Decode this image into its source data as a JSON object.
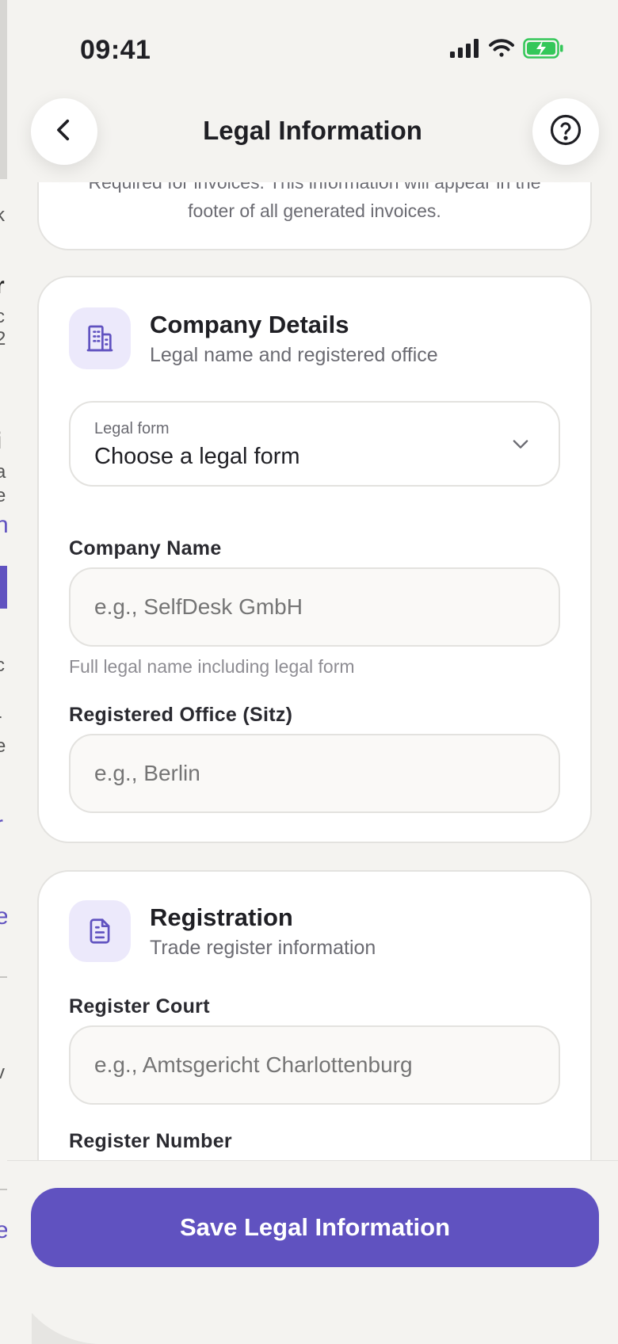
{
  "status_bar": {
    "time": "09:41"
  },
  "header": {
    "title": "Legal Information"
  },
  "info_card": {
    "text": "Required for invoices. This information will appear in the footer of all generated invoices."
  },
  "company_section": {
    "title": "Company Details",
    "subtitle": "Legal name and registered office",
    "legal_form": {
      "label": "Legal form",
      "value": "Choose a legal form"
    },
    "company_name": {
      "label": "Company Name",
      "placeholder": "e.g., SelfDesk GmbH",
      "help": "Full legal name including legal form"
    },
    "registered_office": {
      "label": "Registered Office (Sitz)",
      "placeholder": "e.g., Berlin"
    }
  },
  "registration_section": {
    "title": "Registration",
    "subtitle": "Trade register information",
    "register_court": {
      "label": "Register Court",
      "placeholder": "e.g., Amtsgericht Charlottenburg"
    },
    "register_number": {
      "label": "Register Number"
    }
  },
  "bottom": {
    "save_label": "Save Legal Information"
  },
  "background_fragments": [
    "k",
    "r",
    "c",
    "2",
    "i",
    "a",
    "e",
    "n",
    "c",
    "r",
    "e",
    "r",
    "e",
    "v",
    "e"
  ],
  "colors": {
    "accent": "#6052c0",
    "icon_bg": "#ece9fb",
    "battery": "#34c759"
  },
  "icons": [
    "back-arrow-icon",
    "help-circle-icon",
    "building-icon",
    "document-icon",
    "chevron-down-icon",
    "signal-icon",
    "wifi-icon",
    "battery-charging-icon"
  ]
}
